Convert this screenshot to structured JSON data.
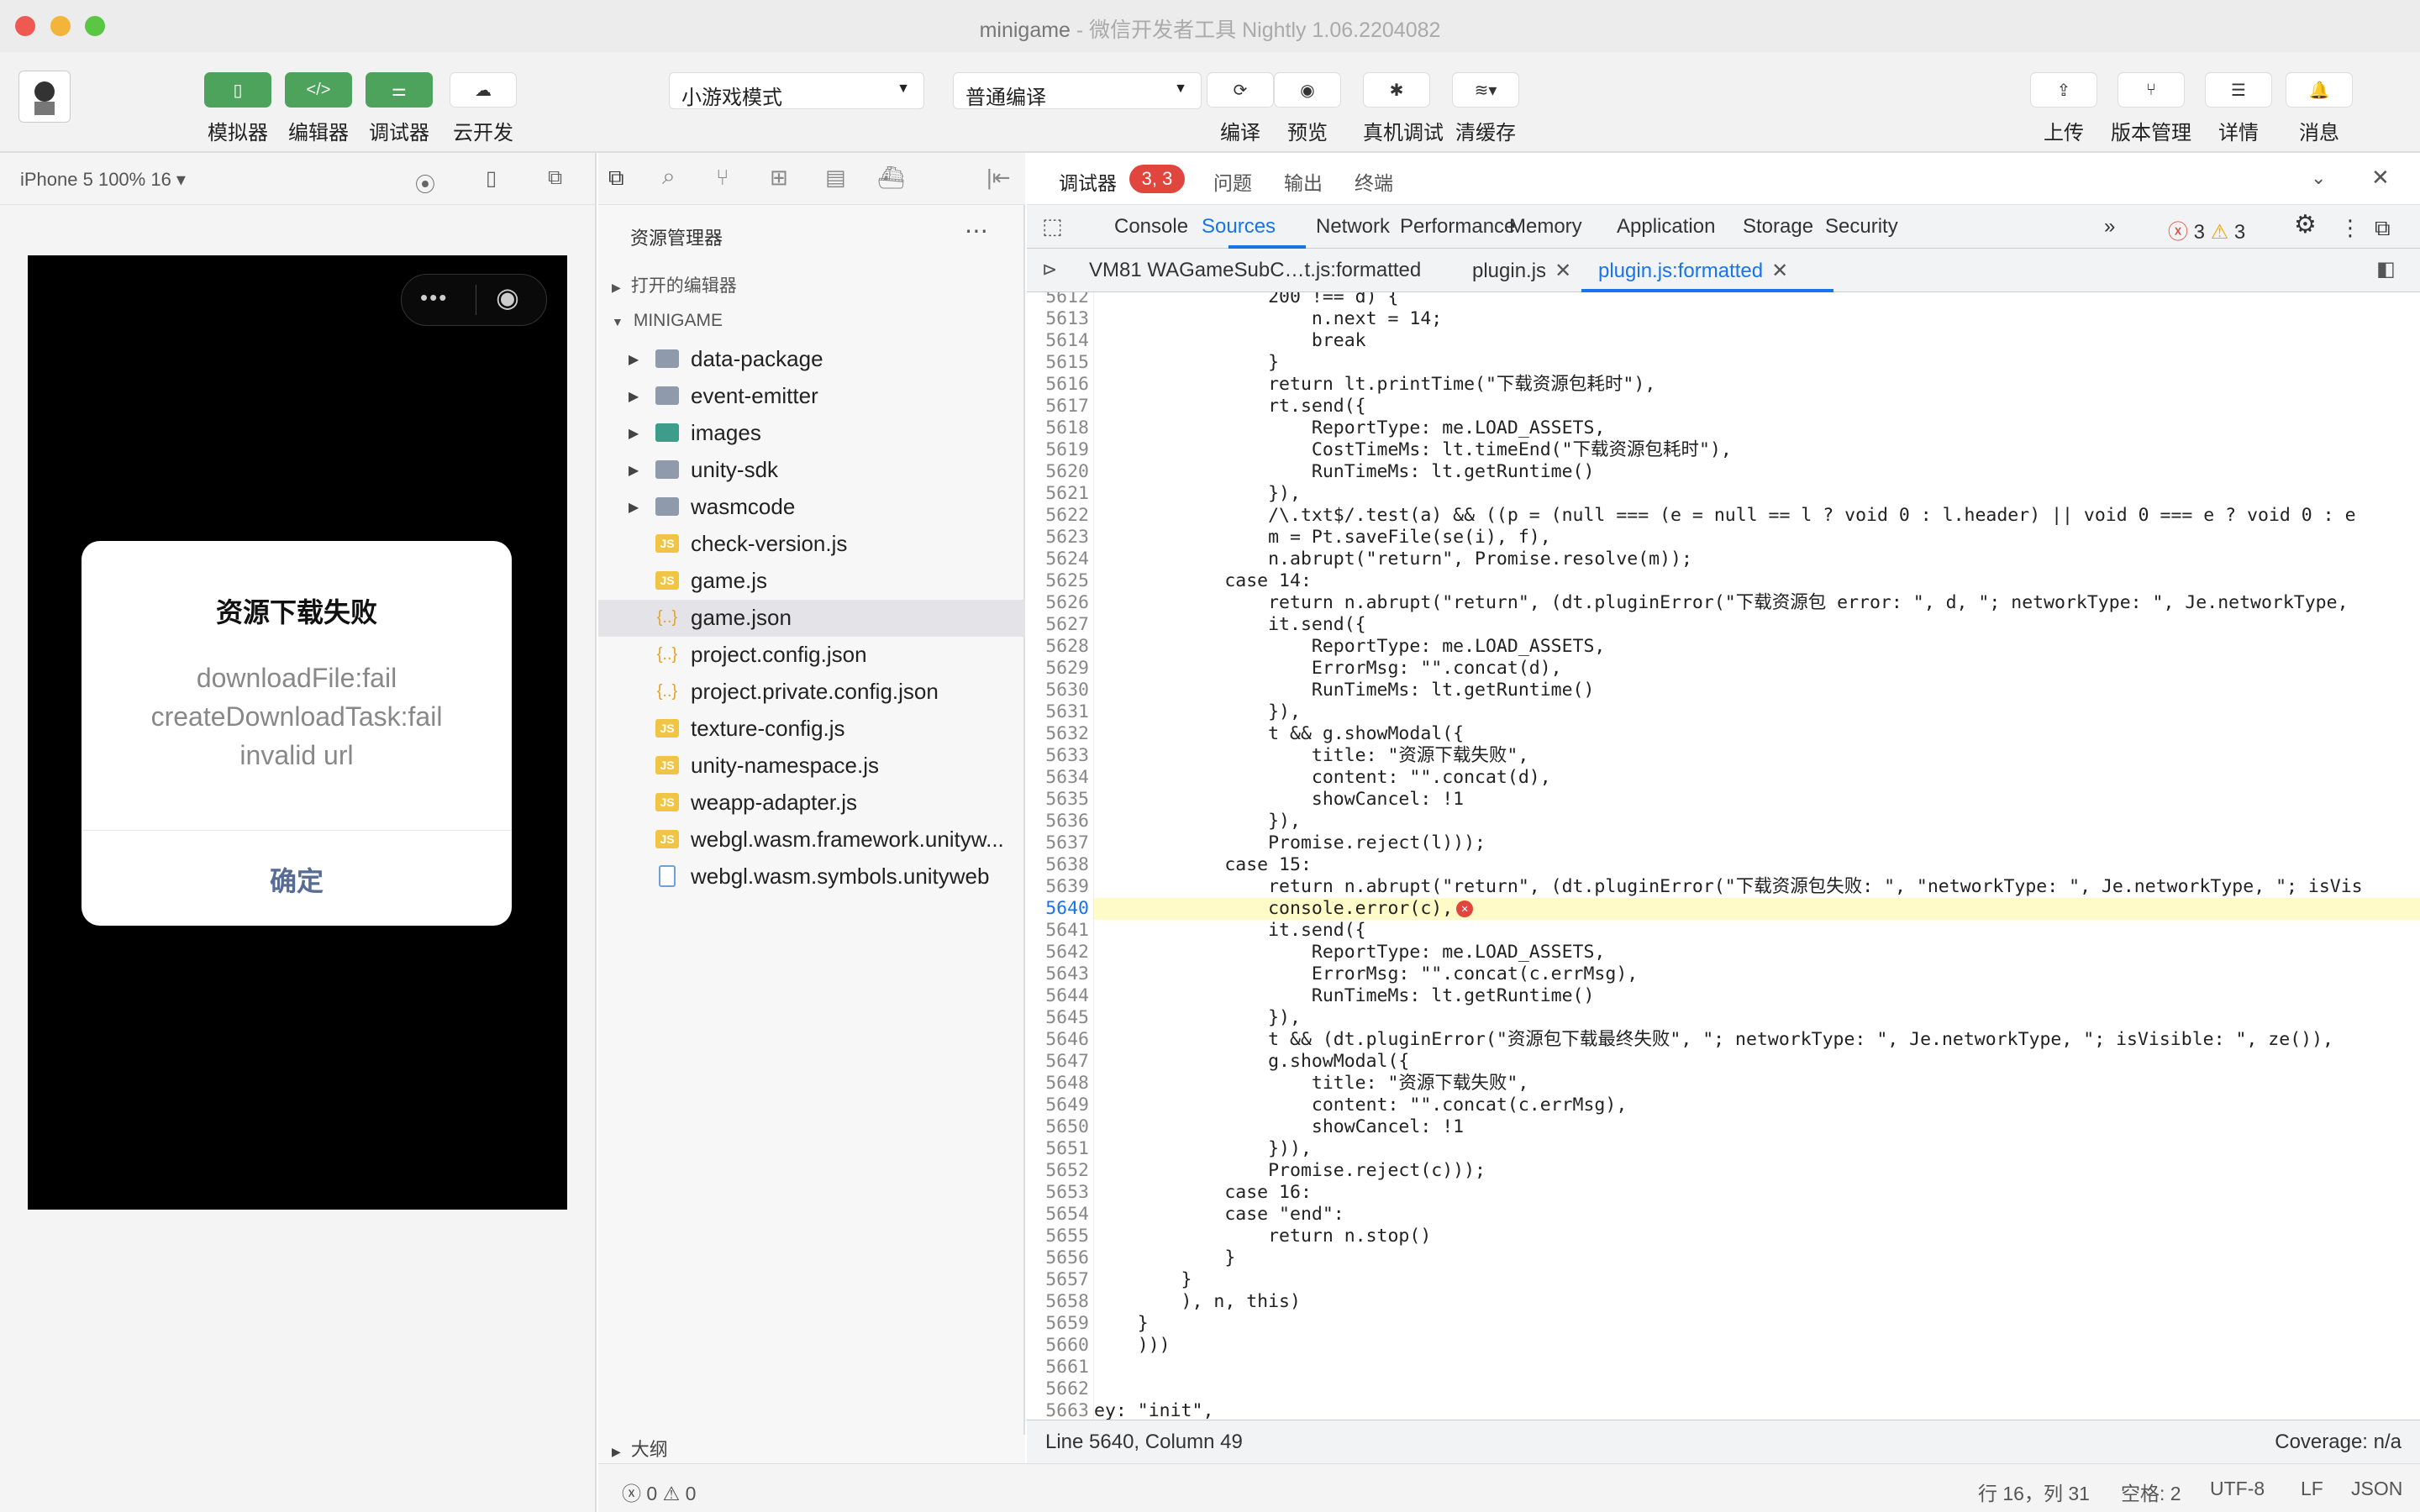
{
  "window": {
    "title": "minigame",
    "title_sep": " - ",
    "subtitle": "微信开发者工具 Nightly 1.06.2204082"
  },
  "toolbar": {
    "simulator": "模拟器",
    "editor": "编辑器",
    "debugger": "调试器",
    "cloud": "云开发",
    "mode_select": "小游戏模式",
    "compile_select": "普通编译",
    "compile": "编译",
    "preview": "预览",
    "device_debug": "真机调试",
    "clear_cache": "清缓存",
    "upload": "上传",
    "version": "版本管理",
    "details": "详情",
    "messages": "消息"
  },
  "simulator": {
    "device": "iPhone 5 100% 16 ▾",
    "modal": {
      "title": "资源下载失败",
      "content": "downloadFile:fail createDownloadTask:fail invalid url",
      "confirm": "确定"
    }
  },
  "explorer": {
    "title": "资源管理器",
    "open_editors": "打开的编辑器",
    "project": "MINIGAME",
    "outline": "大纲",
    "files": [
      {
        "name": "data-package",
        "type": "folder"
      },
      {
        "name": "event-emitter",
        "type": "folder"
      },
      {
        "name": "images",
        "type": "imgfolder"
      },
      {
        "name": "unity-sdk",
        "type": "folder"
      },
      {
        "name": "wasmcode",
        "type": "folder"
      },
      {
        "name": "check-version.js",
        "type": "js"
      },
      {
        "name": "game.js",
        "type": "js"
      },
      {
        "name": "game.json",
        "type": "json",
        "selected": true
      },
      {
        "name": "project.config.json",
        "type": "json"
      },
      {
        "name": "project.private.config.json",
        "type": "json"
      },
      {
        "name": "texture-config.js",
        "type": "js"
      },
      {
        "name": "unity-namespace.js",
        "type": "js"
      },
      {
        "name": "weapp-adapter.js",
        "type": "js"
      },
      {
        "name": "webgl.wasm.framework.unityw...",
        "type": "js"
      },
      {
        "name": "webgl.wasm.symbols.unityweb",
        "type": "file"
      }
    ]
  },
  "debug_tabs": {
    "debugger": "调试器",
    "badge": "3, 3",
    "issues": "问题",
    "output": "输出",
    "terminal": "终端"
  },
  "devtools": {
    "tabs": [
      "Console",
      "Sources",
      "Network",
      "Performance",
      "Memory",
      "Application",
      "Storage",
      "Security"
    ],
    "more": "»",
    "errors": "3",
    "warnings": "3",
    "file_tabs": [
      "VM81 WAGameSubC…t.js:formatted",
      "plugin.js",
      "plugin.js:formatted"
    ]
  },
  "code": [
    {
      "n": "5612",
      "t": "                200 !== d) {"
    },
    {
      "n": "5613",
      "t": "                    n.next = 14;"
    },
    {
      "n": "5614",
      "t": "                    break"
    },
    {
      "n": "5615",
      "t": "                }"
    },
    {
      "n": "5616",
      "t": "                return lt.printTime(\"下载资源包耗时\"),"
    },
    {
      "n": "5617",
      "t": "                rt.send({"
    },
    {
      "n": "5618",
      "t": "                    ReportType: me.LOAD_ASSETS,"
    },
    {
      "n": "5619",
      "t": "                    CostTimeMs: lt.timeEnd(\"下载资源包耗时\"),"
    },
    {
      "n": "5620",
      "t": "                    RunTimeMs: lt.getRuntime()"
    },
    {
      "n": "5621",
      "t": "                }),"
    },
    {
      "n": "5622",
      "t": "                /\\.txt$/.test(a) && ((p = (null === (e = null == l ? void 0 : l.header) || void 0 === e ? void 0 : e"
    },
    {
      "n": "5623",
      "t": "                m = Pt.saveFile(se(i), f),"
    },
    {
      "n": "5624",
      "t": "                n.abrupt(\"return\", Promise.resolve(m));"
    },
    {
      "n": "5625",
      "t": "            case 14:"
    },
    {
      "n": "5626",
      "t": "                return n.abrupt(\"return\", (dt.pluginError(\"下载资源包 error: \", d, \"; networkType: \", Je.networkType,"
    },
    {
      "n": "5627",
      "t": "                it.send({"
    },
    {
      "n": "5628",
      "t": "                    ReportType: me.LOAD_ASSETS,"
    },
    {
      "n": "5629",
      "t": "                    ErrorMsg: \"\".concat(d),"
    },
    {
      "n": "5630",
      "t": "                    RunTimeMs: lt.getRuntime()"
    },
    {
      "n": "5631",
      "t": "                }),"
    },
    {
      "n": "5632",
      "t": "                t && g.showModal({"
    },
    {
      "n": "5633",
      "t": "                    title: \"资源下载失败\","
    },
    {
      "n": "5634",
      "t": "                    content: \"\".concat(d),"
    },
    {
      "n": "5635",
      "t": "                    showCancel: !1"
    },
    {
      "n": "5636",
      "t": "                }),"
    },
    {
      "n": "5637",
      "t": "                Promise.reject(l)));"
    },
    {
      "n": "5638",
      "t": "            case 15:"
    },
    {
      "n": "5639",
      "t": "                return n.abrupt(\"return\", (dt.pluginError(\"下载资源包失败: \", \"networkType: \", Je.networkType, \"; isVis"
    },
    {
      "n": "5640",
      "t": "                console.error(c),",
      "hl": true
    },
    {
      "n": "5641",
      "t": "                it.send({"
    },
    {
      "n": "5642",
      "t": "                    ReportType: me.LOAD_ASSETS,"
    },
    {
      "n": "5643",
      "t": "                    ErrorMsg: \"\".concat(c.errMsg),"
    },
    {
      "n": "5644",
      "t": "                    RunTimeMs: lt.getRuntime()"
    },
    {
      "n": "5645",
      "t": "                }),"
    },
    {
      "n": "5646",
      "t": "                t && (dt.pluginError(\"资源包下载最终失败\", \"; networkType: \", Je.networkType, \"; isVisible: \", ze()),"
    },
    {
      "n": "5647",
      "t": "                g.showModal({"
    },
    {
      "n": "5648",
      "t": "                    title: \"资源下载失败\","
    },
    {
      "n": "5649",
      "t": "                    content: \"\".concat(c.errMsg),"
    },
    {
      "n": "5650",
      "t": "                    showCancel: !1"
    },
    {
      "n": "5651",
      "t": "                })),"
    },
    {
      "n": "5652",
      "t": "                Promise.reject(c)));"
    },
    {
      "n": "5653",
      "t": "            case 16:"
    },
    {
      "n": "5654",
      "t": "            case \"end\":"
    },
    {
      "n": "5655",
      "t": "                return n.stop()"
    },
    {
      "n": "5656",
      "t": "            }"
    },
    {
      "n": "5657",
      "t": "        }"
    },
    {
      "n": "5658",
      "t": "        ), n, this)"
    },
    {
      "n": "5659",
      "t": "    }"
    },
    {
      "n": "5660",
      "t": "    )))"
    },
    {
      "n": "5661",
      "t": ""
    },
    {
      "n": "5662",
      "t": ""
    },
    {
      "n": "5663",
      "t": "ey: \"init\","
    }
  ],
  "status": {
    "position": "Line 5640, Column 49",
    "coverage": "Coverage: n/a"
  },
  "bottom": {
    "errors": "0",
    "warnings": "0",
    "cursor": "行 16，列 31",
    "spaces": "空格: 2",
    "encoding": "UTF-8",
    "eol": "LF",
    "lang": "JSON"
  }
}
